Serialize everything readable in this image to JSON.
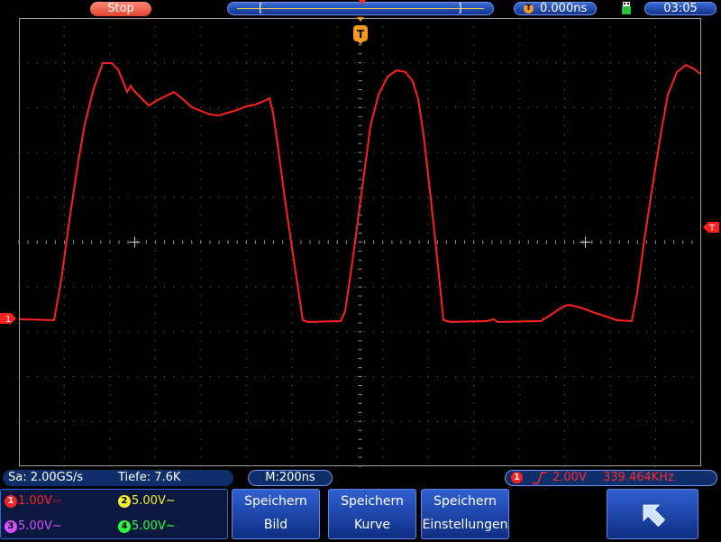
{
  "topbar": {
    "run_state": "Stop",
    "bracket_left": "[",
    "bracket_right": "]",
    "trigger_offset_badge": "T",
    "trigger_offset": "0.000ns",
    "clock": "03:05"
  },
  "markers": {
    "ch1": "1",
    "trigger_level": "T",
    "trigger_position": "T"
  },
  "status": {
    "sample_rate": "Sa: 2.00GS/s",
    "depth": "Tiefe: 7.6K",
    "timebase": "M:200ns",
    "trigger_channel": "1",
    "trigger_level": "2.00V",
    "frequency": "339.464KHz"
  },
  "channels": [
    {
      "num": "1",
      "label": "1.00V",
      "coupling": "⎓",
      "color": "#ff2020"
    },
    {
      "num": "2",
      "label": "5.00V",
      "coupling": "∼",
      "color": "#f4ee2a"
    },
    {
      "num": "3",
      "label": "5.00V",
      "coupling": "∼",
      "color": "#d850ff"
    },
    {
      "num": "4",
      "label": "5.00V",
      "coupling": "∼",
      "color": "#2aff3a"
    }
  ],
  "softkeys": [
    {
      "line1": "Speichern",
      "line2": "Bild"
    },
    {
      "line1": "Speichern",
      "line2": "Kurve"
    },
    {
      "line1": "Speichern",
      "line2": "Einstellungen"
    }
  ],
  "icons": {
    "back": "back-arrow-icon",
    "usb": "usb-icon",
    "rising_edge": "rising-edge-icon"
  },
  "colors": {
    "ch1": "#ff2020",
    "grid": "#9a9a9a",
    "trigger": "#f39a1a",
    "panel_blue": "#2f5fd0"
  }
}
